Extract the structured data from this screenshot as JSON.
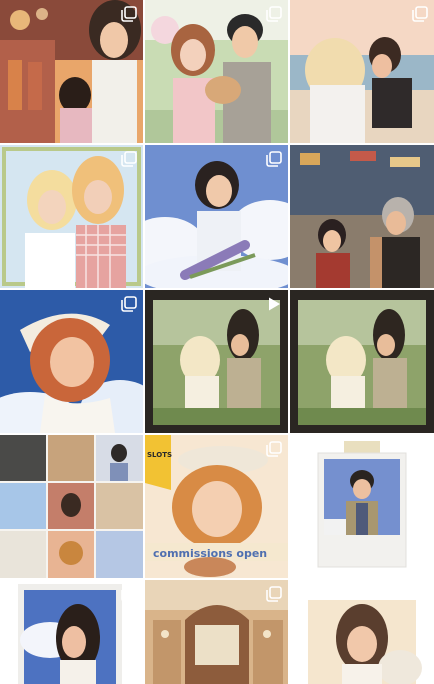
{
  "feed": {
    "posts": [
      {
        "id": 1,
        "type": "carousel",
        "subject": "sunset-fireworks-couple",
        "palette": [
          "#f0a86a",
          "#c86a3a",
          "#2c2a3a"
        ]
      },
      {
        "id": 2,
        "type": "carousel",
        "subject": "couple-with-cat",
        "palette": [
          "#bcd2a8",
          "#f3d6cc",
          "#8a7a6a"
        ]
      },
      {
        "id": 3,
        "type": "carousel",
        "subject": "beach-hug",
        "palette": [
          "#f1c3a6",
          "#e9d8c0",
          "#6a4a3a"
        ]
      },
      {
        "id": 4,
        "type": "carousel",
        "subject": "two-girls-window",
        "palette": [
          "#cfe3f2",
          "#f4dba2",
          "#e6a7a2"
        ]
      },
      {
        "id": 5,
        "type": "carousel",
        "subject": "girl-with-lavender",
        "palette": [
          "#6f8fd0",
          "#f1f4fb",
          "#7c6aa8"
        ]
      },
      {
        "id": 6,
        "type": "carousel",
        "subject": "city-street-couple",
        "palette": [
          "#6b7a8f",
          "#b89376",
          "#3a2f2a"
        ]
      },
      {
        "id": 7,
        "type": "carousel",
        "subject": "girl-bandana-sky",
        "palette": [
          "#2d5ba8",
          "#f3c3a0",
          "#c45f3a"
        ]
      },
      {
        "id": 8,
        "type": "video",
        "subject": "forest-couple-anim",
        "palette": [
          "#8ea36a",
          "#f2e6c8",
          "#3b332b"
        ]
      },
      {
        "id": 9,
        "type": "none",
        "subject": "forest-couple-still",
        "palette": [
          "#8ea36a",
          "#f2e6c8",
          "#3b332b"
        ]
      },
      {
        "id": 10,
        "type": "none",
        "subject": "portfolio-collage",
        "palette": [
          "#dcd2c2",
          "#a9927a",
          "#5d6e8c"
        ]
      },
      {
        "id": 11,
        "type": "carousel",
        "subject": "commissions-open",
        "palette": [
          "#f5d8bd",
          "#e3a35b",
          "#4f6fb0"
        ],
        "banner_text": "commissions open",
        "tag_text": "SLOTS"
      },
      {
        "id": 12,
        "type": "none",
        "subject": "polaroid-man-vest",
        "palette": [
          "#eae7e1",
          "#6f86c8",
          "#8a7a5a"
        ]
      },
      {
        "id": 13,
        "type": "carousel",
        "subject": "polaroid-girl-sky",
        "palette": [
          "#eae7e1",
          "#4f73c2",
          "#2a1f1a"
        ]
      },
      {
        "id": 14,
        "type": "carousel",
        "subject": "vintage-shop-interior",
        "palette": [
          "#d8b890",
          "#8c5a3a",
          "#efe0c4"
        ]
      },
      {
        "id": 15,
        "type": "none",
        "subject": "girl-with-flowers",
        "palette": [
          "#f4e3c9",
          "#6a4a38",
          "#e9e2d6"
        ]
      }
    ],
    "icons": {
      "carousel": "carousel-icon",
      "video": "video-play-icon"
    }
  }
}
